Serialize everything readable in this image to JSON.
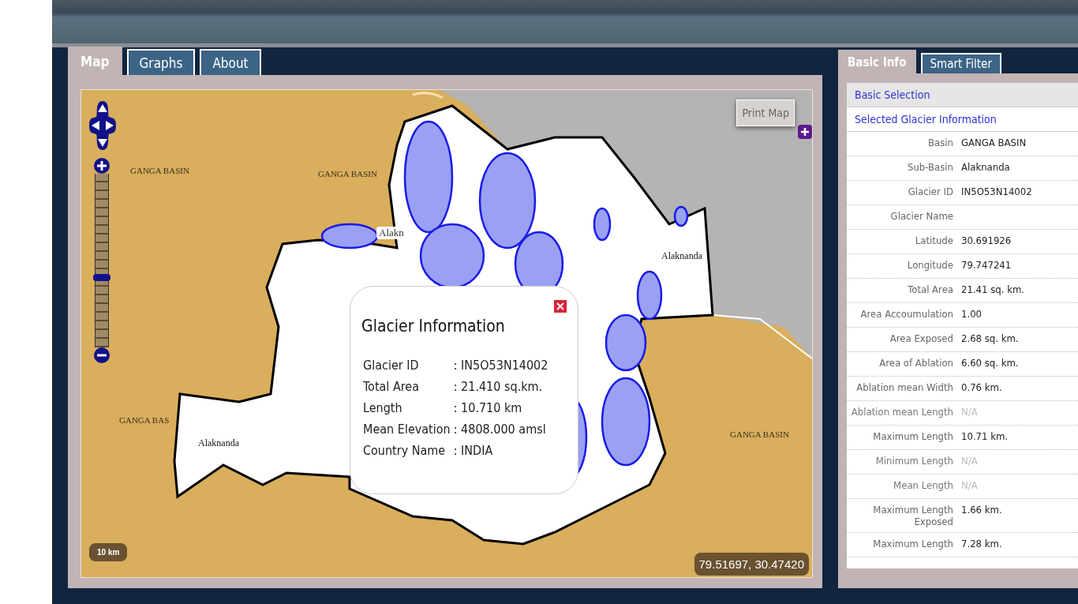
{
  "left_tabs": [
    {
      "label": "Map",
      "selected": true
    },
    {
      "label": "Graphs",
      "selected": false
    },
    {
      "label": "About",
      "selected": false
    }
  ],
  "map": {
    "print_button": "Print Map",
    "scale": "10 km",
    "coordinates": "79.51697, 30.47420",
    "zoom": {
      "level": 0.4
    },
    "labels": [
      {
        "text": "GANGA BASIN",
        "kind": "basin"
      },
      {
        "text": "GANGA BASIN",
        "kind": "basin"
      },
      {
        "text": "GANGA BAS",
        "kind": "basin"
      },
      {
        "text": "GANGA BASIN",
        "kind": "basin"
      },
      {
        "text": "Alakn",
        "kind": "tag"
      },
      {
        "text": "Alaknanda",
        "kind": "basin-name"
      },
      {
        "text": "Alaknanda",
        "kind": "basin-name"
      }
    ],
    "popup": {
      "title": "Glacier Information",
      "rows": [
        {
          "label": "Glacier ID",
          "value": ": IN5O53N14002"
        },
        {
          "label": "Total Area",
          "value": ": 21.410 sq.km."
        },
        {
          "label": "Length",
          "value": ": 10.710 km"
        },
        {
          "label": "Mean Elevation",
          "value": ": 4808.000 amsl"
        },
        {
          "label": "Country Name",
          "value": ": INDIA"
        }
      ]
    }
  },
  "right_tabs": [
    {
      "label": "Basic Info",
      "selected": true
    },
    {
      "label": "Smart Filter",
      "selected": false
    }
  ],
  "info": {
    "sections": [
      "Basic Selection",
      "Selected Glacier Information"
    ],
    "rows": [
      {
        "label": "Basin",
        "value": "GANGA BASIN",
        "muted": false
      },
      {
        "label": "Sub-Basin",
        "value": "Alaknanda",
        "muted": false
      },
      {
        "label": "Glacier ID",
        "value": "IN5O53N14002",
        "muted": false
      },
      {
        "label": "Glacier Name",
        "value": "",
        "muted": false
      },
      {
        "label": "Latitude",
        "value": "30.691926",
        "muted": false
      },
      {
        "label": "Longitude",
        "value": "79.747241",
        "muted": false
      },
      {
        "label": "Total Area",
        "value": "21.41 sq. km.",
        "muted": false
      },
      {
        "label": "Area Accoumulation",
        "value": "1.00",
        "muted": false
      },
      {
        "label": "Area Exposed",
        "value": "2.68 sq. km.",
        "muted": false
      },
      {
        "label": "Area of Ablation",
        "value": "6.60 sq. km.",
        "muted": false
      },
      {
        "label": "Ablation mean Width",
        "value": "0.76 km.",
        "muted": false
      },
      {
        "label": "Ablation mean Length",
        "value": "N/A",
        "muted": true
      },
      {
        "label": "Maximum Length",
        "value": "10.71 km.",
        "muted": false
      },
      {
        "label": "Minimum Length",
        "value": "N/A",
        "muted": true
      },
      {
        "label": "Mean Length",
        "value": "N/A",
        "muted": true
      },
      {
        "label": "Maximum Length Exposed",
        "value": "1.66 km.",
        "muted": false
      },
      {
        "label": "Maximum Length",
        "value": "7.28 km.",
        "muted": false
      }
    ]
  }
}
